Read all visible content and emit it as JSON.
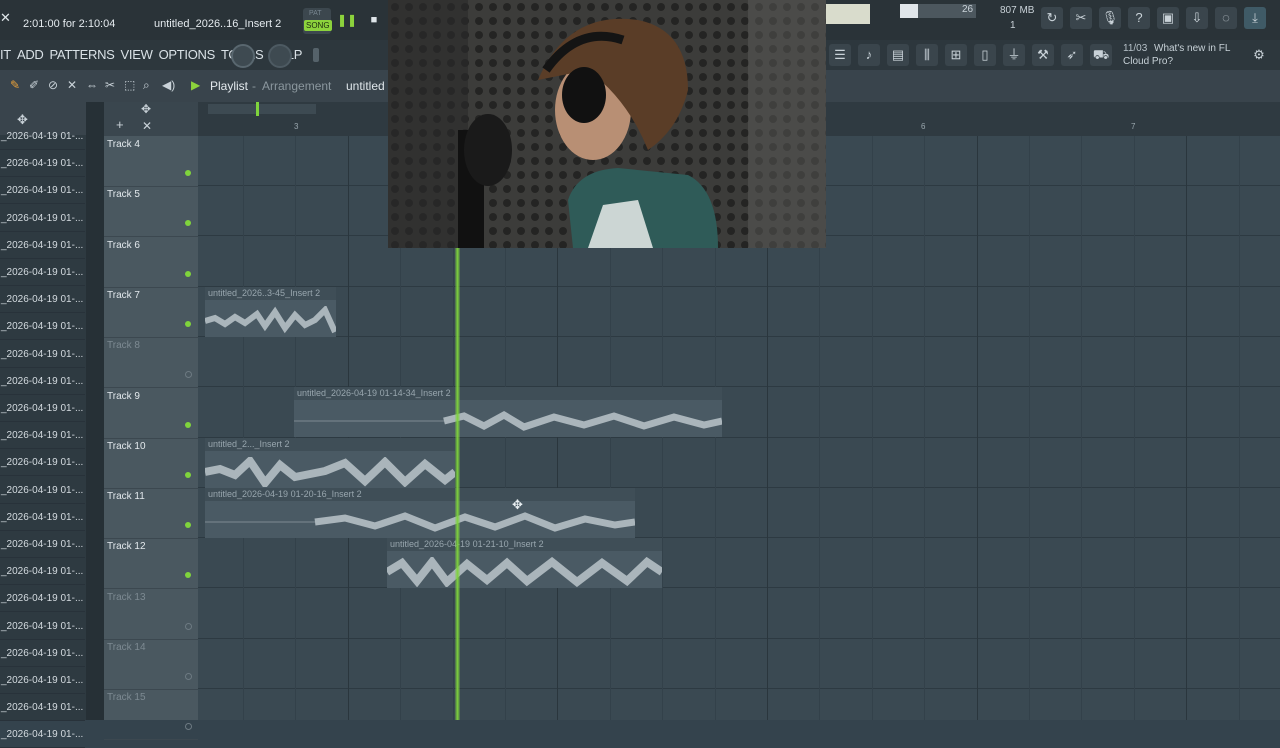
{
  "topbar": {
    "time": "2:01:00 for 2:10:04",
    "project_name": "untitled_2026..16_Insert 2",
    "song_mode": "SONG",
    "pat_mode": "PAT",
    "cpu_value": "26",
    "memory": "807 MB",
    "poly": "1"
  },
  "menu": {
    "items": [
      "IT",
      "ADD",
      "PATTERNS",
      "VIEW",
      "OPTIONS",
      "TOOLS",
      "HELP"
    ]
  },
  "news": {
    "date": "11/03",
    "text": "What's new in FL Cloud Pro?"
  },
  "playlist": {
    "title": "Playlist",
    "subtitle": "Arrangement",
    "project": "untitled",
    "ruler_marks": [
      "3",
      "6",
      "7"
    ]
  },
  "browser": {
    "items": [
      "_2026-04-19 01-...",
      "_2026-04-19 01-...",
      "_2026-04-19 01-...",
      "_2026-04-19 01-...",
      "_2026-04-19 01-...",
      "_2026-04-19 01-...",
      "_2026-04-19 01-...",
      "_2026-04-19 01-...",
      "_2026-04-19 01-...",
      "_2026-04-19 01-...",
      "_2026-04-19 01-...",
      "_2026-04-19 01-...",
      "_2026-04-19 01-...",
      "_2026-04-19 01-...",
      "_2026-04-19 01-...",
      "_2026-04-19 01-...",
      "_2026-04-19 01-...",
      "_2026-04-19 01-...",
      "_2026-04-19 01-...",
      "_2026-04-19 01-...",
      "_2026-04-19 01-...",
      "_2026-04-19 01-...",
      "_2026-04-19 01-..."
    ]
  },
  "tracks": [
    {
      "label": "Track 4",
      "active": true
    },
    {
      "label": "Track 5",
      "active": true
    },
    {
      "label": "Track 6",
      "active": true
    },
    {
      "label": "Track 7",
      "active": true
    },
    {
      "label": "Track 8",
      "active": false
    },
    {
      "label": "Track 9",
      "active": true
    },
    {
      "label": "Track 10",
      "active": true
    },
    {
      "label": "Track 11",
      "active": true
    },
    {
      "label": "Track 12",
      "active": true
    },
    {
      "label": "Track 13",
      "active": false
    },
    {
      "label": "Track 14",
      "active": false
    },
    {
      "label": "Track 15",
      "active": false
    }
  ],
  "clips": [
    {
      "title": "untitled_2026..3-45_Insert 2"
    },
    {
      "title": "untitled_2026-04-19 01-14-34_Insert 2"
    },
    {
      "title": "untitled_2..._Insert 2"
    },
    {
      "title": "untitled_2026-04-19 01-20-16_Insert 2"
    },
    {
      "title": "untitled_2026-04-19 01-21-10_Insert 2"
    }
  ],
  "colors": {
    "accent_green": "#7fd33c",
    "grid_bg": "#3a4952",
    "clip_bg": "#4a5a64"
  }
}
